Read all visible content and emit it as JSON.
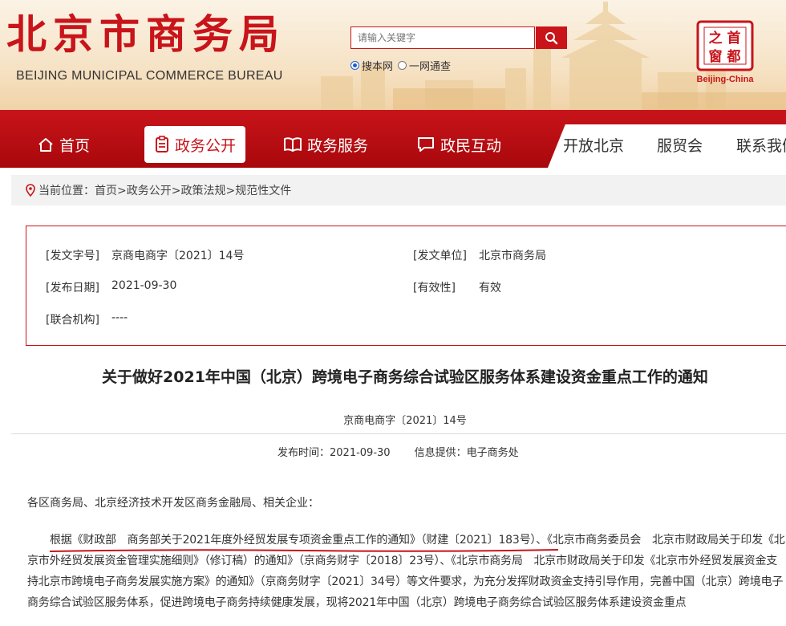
{
  "header": {
    "logo_cn": "北京市商务局",
    "logo_en": "BEIJING MUNICIPAL COMMERCE BUREAU",
    "search_placeholder": "请输入关键字",
    "scope_options": [
      "搜本网",
      "一网通查"
    ],
    "scope_selected": "搜本网",
    "badge_chars": [
      "首",
      "都",
      "之",
      "窗"
    ],
    "badge_caption": "Beijing-China",
    "accent": "#c8141a"
  },
  "nav": {
    "items": [
      {
        "label": "首页",
        "icon": "home-icon"
      },
      {
        "label": "政务公开",
        "icon": "document-icon",
        "active": true
      },
      {
        "label": "政务服务",
        "icon": "book-icon"
      },
      {
        "label": "政民互动",
        "icon": "chat-icon"
      },
      {
        "label": "开放北京"
      },
      {
        "label": "服贸会"
      },
      {
        "label": "联系我们"
      }
    ]
  },
  "breadcrumb": {
    "prefix": "当前位置：",
    "path": "首页>政务公开>政策法规>规范性文件"
  },
  "meta": {
    "doc_no_label": "[发文字号]",
    "doc_no": "京商电商字〔2021〕14号",
    "issuer_label": "[发文单位]",
    "issuer": "北京市商务局",
    "date_label": "[发布日期]",
    "date": "2021-09-30",
    "validity_label": "[有效性]",
    "validity": "有效",
    "joint_label": "[联合机构]",
    "joint": "----"
  },
  "article": {
    "title": "关于做好2021年中国（北京）跨境电子商务综合试验区服务体系建设资金重点工作的通知",
    "doc_no": "京商电商字〔2021〕14号",
    "pub_time": "发布时间：2021-09-30",
    "provider": "信息提供：电子商务处",
    "salutation": "各区商务局、北京经济技术开发区商务金融局、相关企业：",
    "paragraph": "根据《财政部　商务部关于2021年度外经贸发展专项资金重点工作的通知》（财建〔2021〕183号）、《北京市商务委员会　北京市财政局关于印发《北京市外经贸发展资金管理实施细则》（修订稿）的通知》（京商务财字〔2018〕23号）、《北京市商务局　北京市财政局关于印发《北京市外经贸发展资金支持北京市跨境电子商务发展实施方案》的通知》（京商务财字〔2021〕34号）等文件要求，为充分发挥财政资金支持引导作用，完善中国（北京）跨境电子商务综合试验区服务体系，促进跨境电子商务持续健康发展，现将2021年中国（北京）跨境电子商务综合试验区服务体系建设资金重点"
  }
}
